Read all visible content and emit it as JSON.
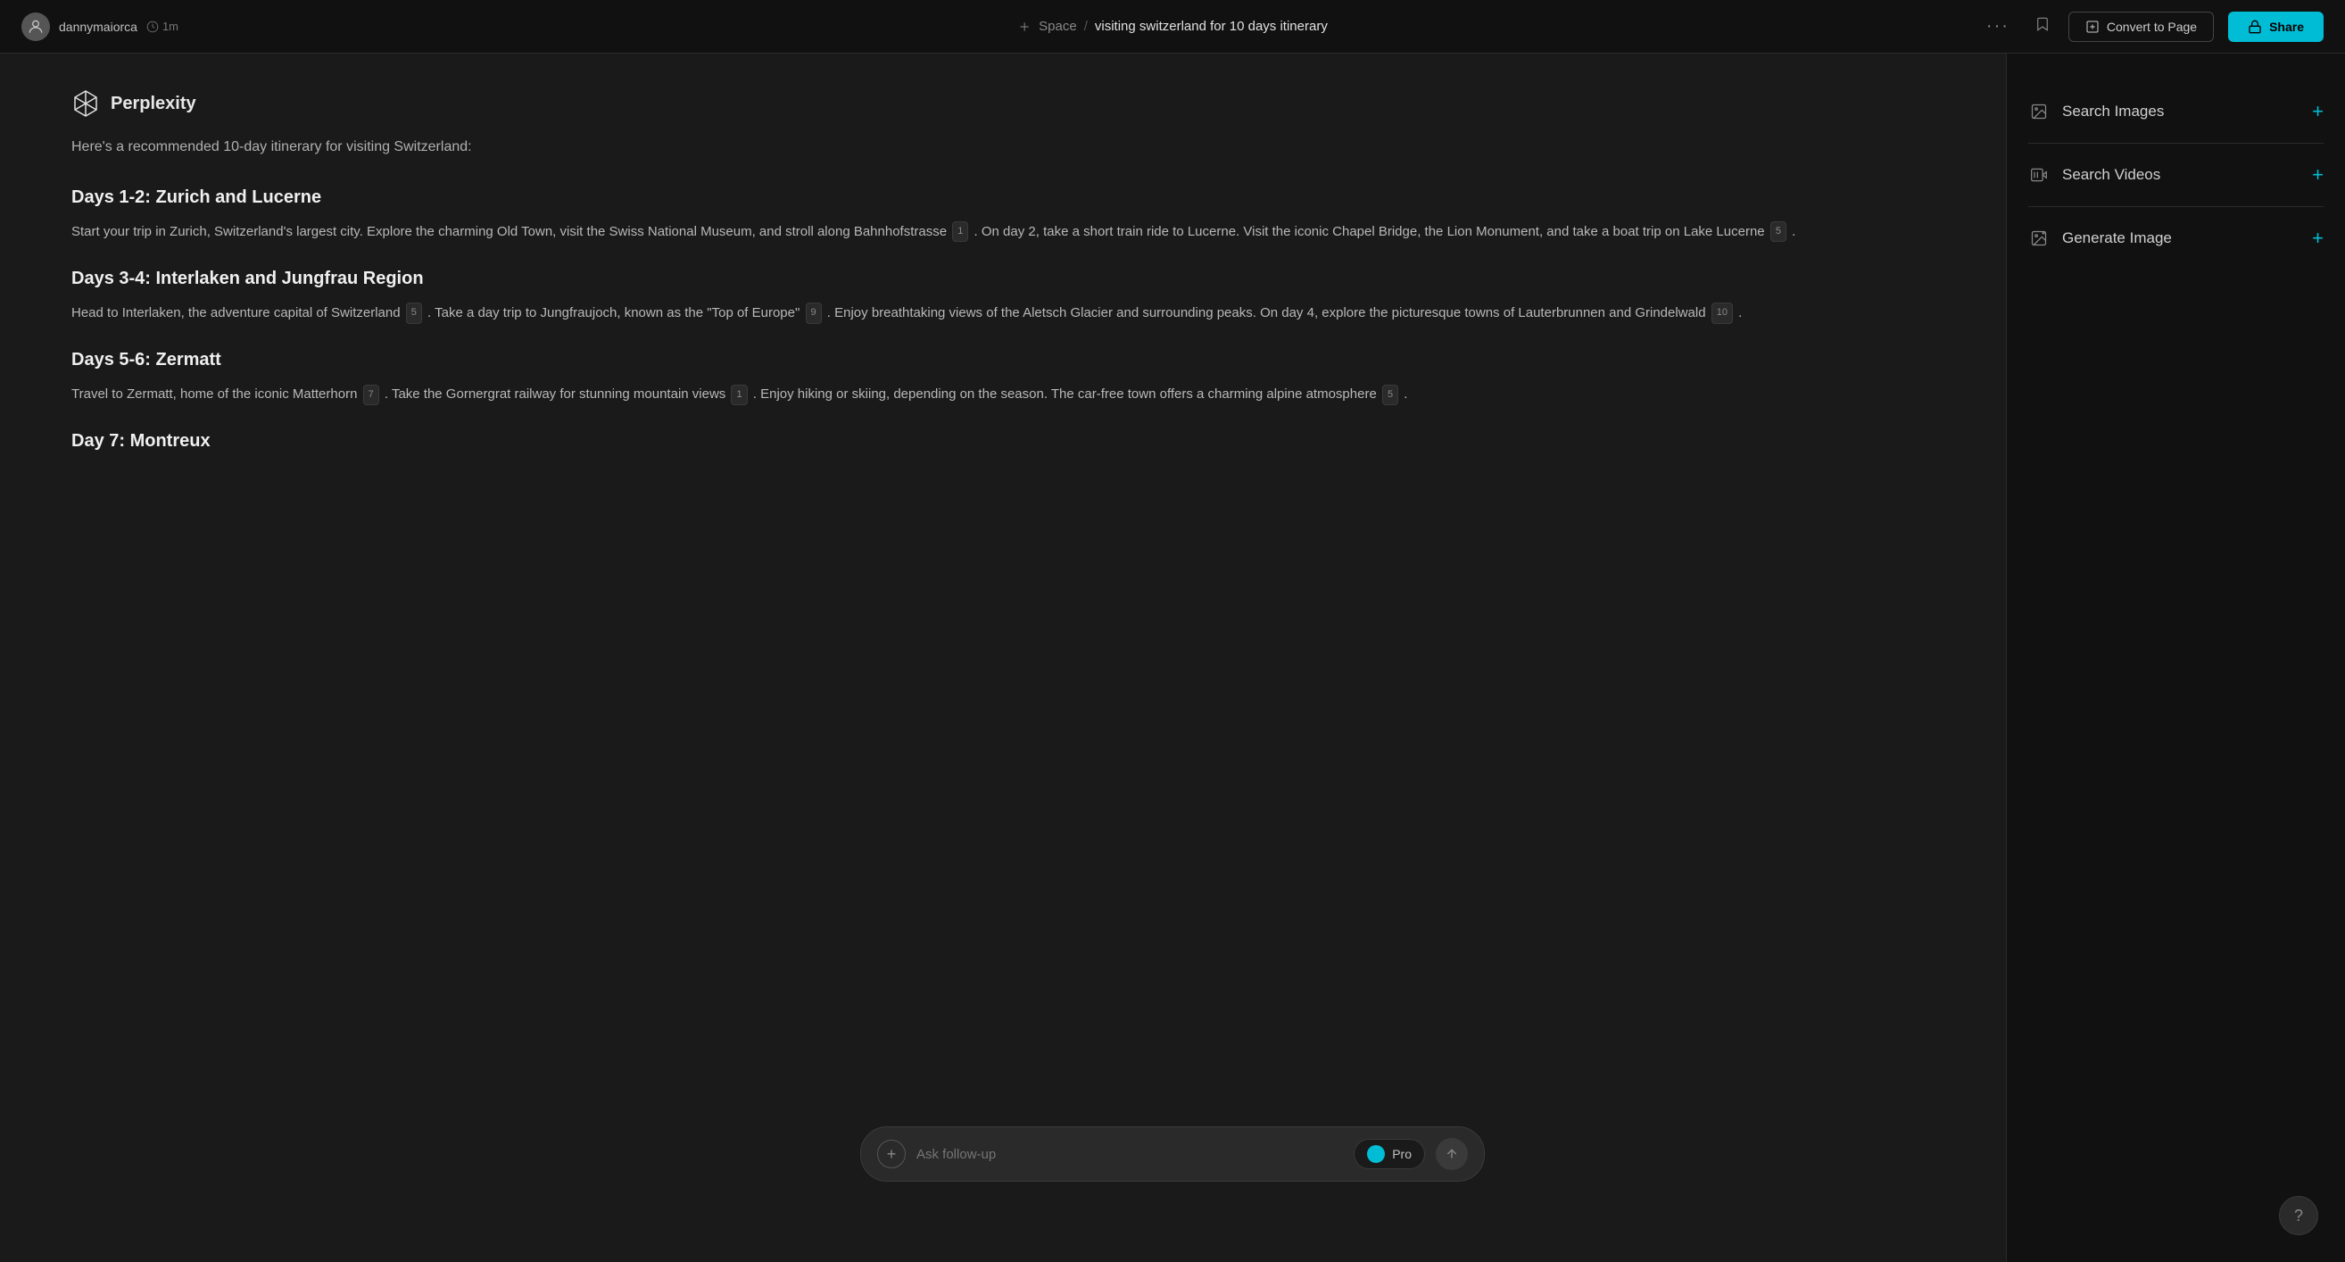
{
  "topbar": {
    "username": "dannymaiorca",
    "time_label": "1m",
    "space_label": "Space",
    "separator": "/",
    "page_title": "visiting switzerland for 10 days itinerary",
    "more_label": "···",
    "convert_label": "Convert to Page",
    "share_label": "Share"
  },
  "perplexity": {
    "brand_name": "Perplexity",
    "intro_text": "Here's a recommended 10-day itinerary for visiting Switzerland:"
  },
  "sections": [
    {
      "heading": "Days 1-2: Zurich and Lucerne",
      "text": "Start your trip in Zurich, Switzerland's largest city. Explore the charming Old Town, visit the Swiss National Museum, and stroll along Bahnhofstrasse",
      "citation1": "1",
      "text2": ". On day 2, take a short train ride to Lucerne. Visit the iconic Chapel Bridge, the Lion Monument, and take a boat trip on Lake Lucerne",
      "citation2": "5",
      "text3": "."
    },
    {
      "heading": "Days 3-4: Interlaken and Jungfrau Region",
      "text": "Head to Interlaken, the adventure capital of Switzerland",
      "citation1": "5",
      "text2": ". Take a day trip to Jungfraujoch, known as the \"Top of Europe\"",
      "citation2": "9",
      "text3": ". Enjoy breathtaking views of the Aletsch Glacier and surrounding peaks. On day 4, explore the picturesque towns of Lauterbrunnen and Grindelwald",
      "citation3": "10",
      "text4": "."
    },
    {
      "heading": "Days 5-6: Zermatt",
      "text": "Travel to Zermatt, home of the iconic Matterhorn",
      "citation1": "7",
      "text2": ". Take the Gornergrat railway for stunning mountain views",
      "citation2": "1",
      "text3": ". Enjoy hiking or skiing, depending on the season. The car-free town offers a charming alpine atmosphere",
      "citation3": "5",
      "text4": "."
    },
    {
      "heading": "Day 7: Montreux",
      "text": ""
    }
  ],
  "sidebar": {
    "items": [
      {
        "id": "search-images",
        "label": "Search Images",
        "icon": "image"
      },
      {
        "id": "search-videos",
        "label": "Search Videos",
        "icon": "video"
      },
      {
        "id": "generate-image",
        "label": "Generate Image",
        "icon": "generate"
      }
    ]
  },
  "bottom_input": {
    "placeholder": "Ask follow-up",
    "pro_label": "Pro"
  },
  "help_btn_label": "?"
}
